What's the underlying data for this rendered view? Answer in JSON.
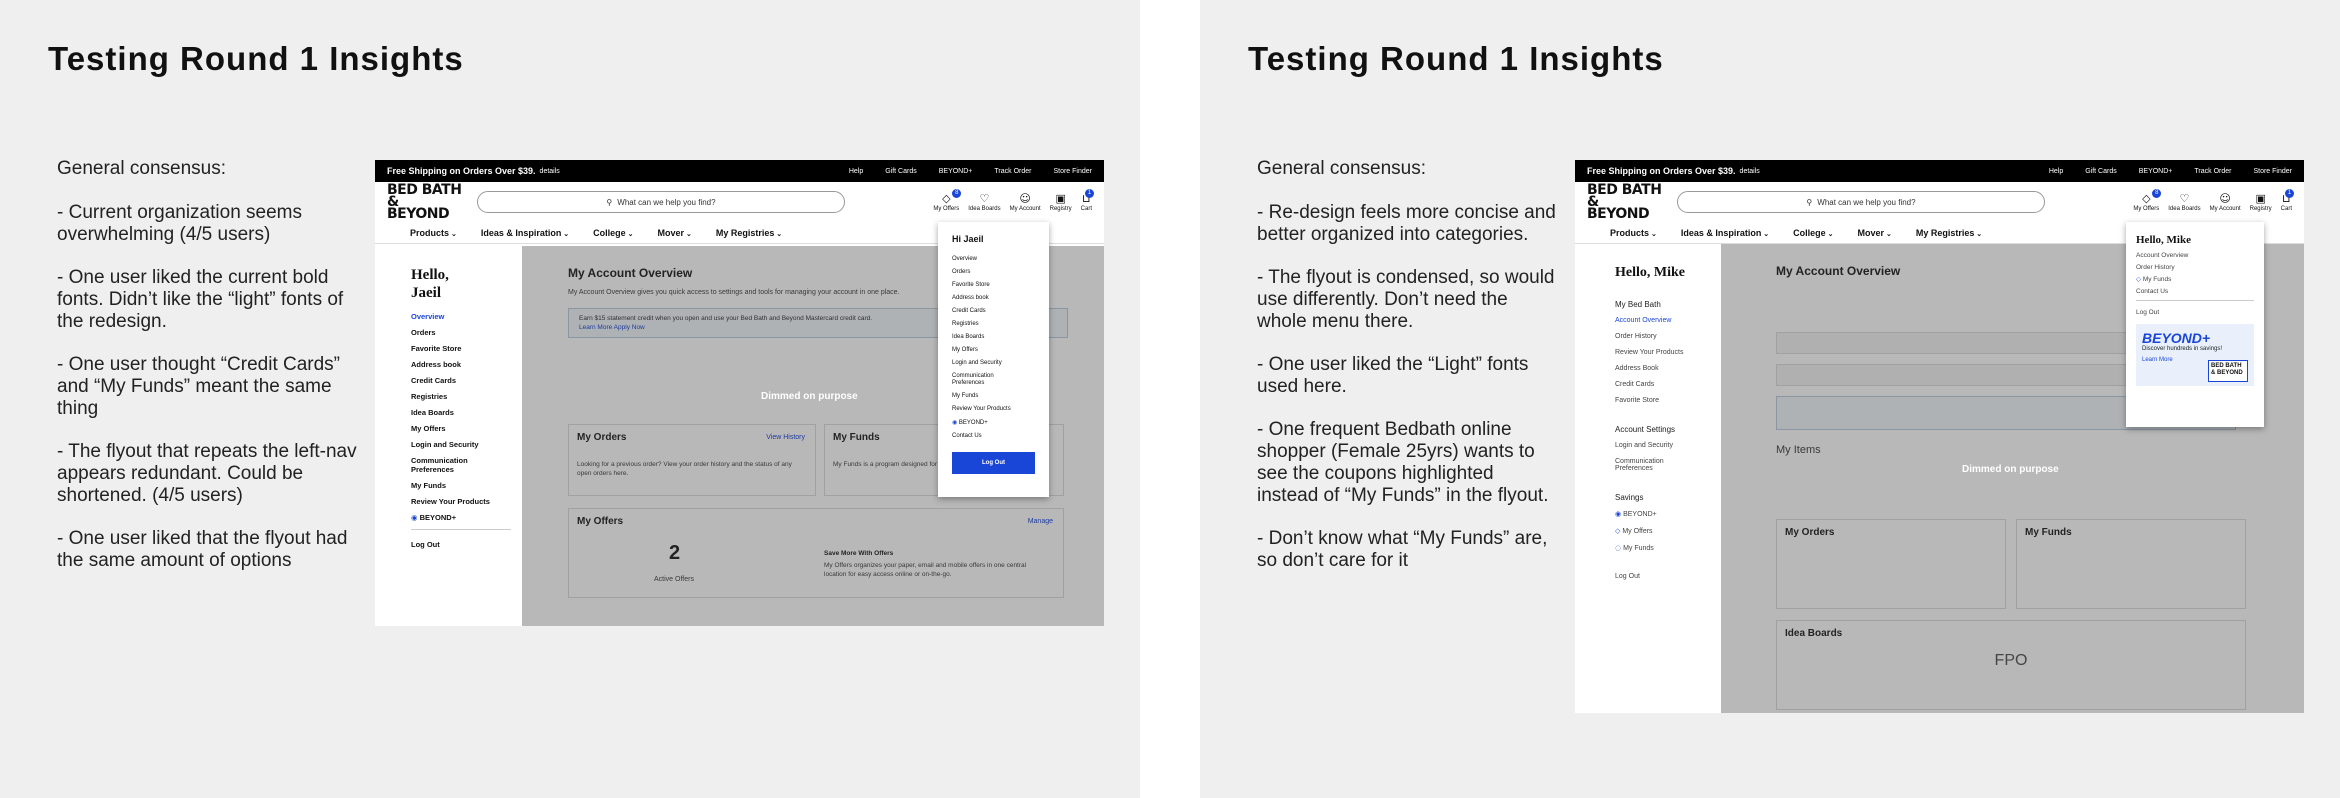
{
  "slides": [
    {
      "title": "Testing Round 1 Insights",
      "notes": [
        "General consensus:",
        "- Current organization seems overwhelming (4/5 users)",
        "- One user liked the current bold fonts. Didn’t like the “light” fonts of the redesign.",
        "- One user thought “Credit Cards” and “My Funds” meant the same thing",
        "- The flyout that repeats the left-nav appears redundant. Could be shortened. (4/5 users)",
        "- One user liked that the flyout had the same amount of options"
      ]
    },
    {
      "title": "Testing Round 1 Insights",
      "notes": [
        "General consensus:",
        "- Re-design feels more concise and better organized into categories.",
        "- The flyout is condensed, so would use differently. Don’t need the whole menu there.",
        "- One user liked the “Light” fonts used here.",
        "- One frequent Bedbath online shopper (Female 25yrs) wants to see the coupons highlighted instead of “My Funds” in the flyout.",
        "- Don’t know what “My Funds” are, so don’t care for it"
      ]
    }
  ],
  "site": {
    "promo": "Free Shipping on Orders Over $39.",
    "promo_details": "details",
    "top_links": [
      "Help",
      "Gift Cards",
      "BEYOND+",
      "Track Order",
      "Store Finder"
    ],
    "logo_line1": "BED BATH &",
    "logo_line2": "BEYOND",
    "search_placeholder": "What can we help you find?",
    "header_icons": [
      {
        "label": "My Offers",
        "icon": "tag-icon",
        "badge": "8"
      },
      {
        "label": "Idea Boards",
        "icon": "heart-icon"
      },
      {
        "label": "My Account",
        "icon": "user-icon"
      },
      {
        "label": "Registry",
        "icon": "gift-icon"
      },
      {
        "label": "Cart",
        "icon": "cart-icon",
        "badge": "1"
      }
    ],
    "nav": [
      "Products",
      "Ideas & Inspiration",
      "College",
      "Mover",
      "My Registries"
    ]
  },
  "mock1": {
    "hello": "Hello, Jaeil",
    "leftnav": [
      "Overview",
      "Orders",
      "Favorite Store",
      "Address book",
      "Credit Cards",
      "Registries",
      "Idea Boards",
      "My Offers",
      "Login and Security",
      "Communication Preferences",
      "My Funds",
      "Review Your Products",
      "BEYOND+"
    ],
    "logout": "Log Out",
    "heading": "My Account Overview",
    "desc": "My Account Overview gives you quick access to settings and tools for managing your account in one place.",
    "banner": "Earn $15 statement credit when you open and use your Bed Bath and Beyond Mastercard credit card.",
    "banner_links": "Learn More   Apply Now",
    "dim_label": "Dimmed on purpose",
    "card_orders_title": "My Orders",
    "card_orders_link": "View History",
    "card_orders_text": "Looking for a previous order? View your order history and the status of any open orders here.",
    "card_funds_title": "My Funds",
    "card_funds_text": "My Funds is a program designed for shopping and engaging",
    "card_offers_title": "My Offers",
    "card_offers_link": "Manage",
    "card_offers_count": "2",
    "card_offers_sub": "Active Offers",
    "card_offers_save": "Save More With Offers",
    "card_offers_text": "My Offers organizes your paper, email and mobile offers in one central location for easy access online or on-the-go.",
    "flyout_title": "Hi Jaeil",
    "flyout_items": [
      "Overview",
      "Orders",
      "Favorite Store",
      "Address book",
      "Credit Cards",
      "Registries",
      "Idea Boards",
      "My Offers",
      "Login and Security",
      "Communication Preferences",
      "My Funds",
      "Review Your Products",
      "BEYOND+",
      "Contact Us"
    ],
    "flyout_button": "Log Out"
  },
  "mock2": {
    "hello": "Hello, Mike",
    "section1": "My Bed Bath",
    "section1_items": [
      "Account Overview",
      "Order History",
      "Review Your Products",
      "Address Book",
      "Credit Cards",
      "Favorite Store"
    ],
    "section2": "Account Settings",
    "section2_items": [
      "Login and Security",
      "Communication Preferences"
    ],
    "section3": "Savings",
    "section3_items": [
      "BEYOND+",
      "My Offers",
      "My Funds"
    ],
    "logout": "Log Out",
    "heading": "My Account Overview",
    "dim_label": "Dimmed on purpose",
    "my_items": "My Items",
    "card_orders_title": "My Orders",
    "card_funds_title": "My Funds",
    "idea_boards": "Idea Boards",
    "fpo": "FPO",
    "flyout_title": "Hello, Mike",
    "flyout_items": [
      "Account Overview",
      "Order History",
      "My Funds"
    ],
    "flyout_contact": "Contact Us",
    "flyout_logout": "Log Out",
    "beyond_title": "BEYOND+",
    "beyond_sub": "Discover hundreds in savings!",
    "beyond_link": "Learn More",
    "beyond_logo": "BED BATH & BEYOND"
  }
}
